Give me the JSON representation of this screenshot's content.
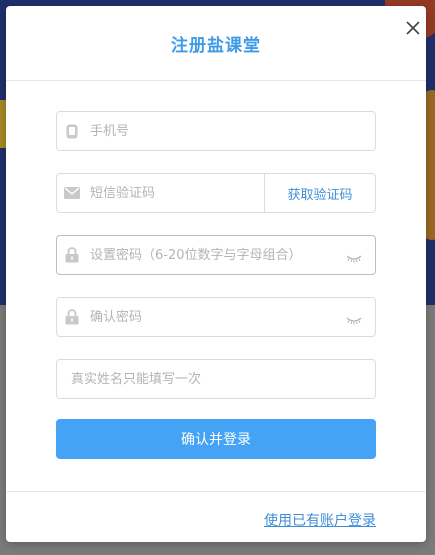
{
  "modal": {
    "title": "注册盐课堂",
    "close_icon": "close-icon"
  },
  "form": {
    "phone_placeholder": "手机号",
    "sms_code_placeholder": "短信验证码",
    "get_code_label": "获取验证码",
    "password_placeholder": "设置密码（6-20位数字与字母组合）",
    "confirm_password_placeholder": "确认密码",
    "real_name_placeholder": "真实姓名只能填写一次",
    "submit_label": "确认并登录"
  },
  "footer": {
    "existing_account_link": "使用已有账户登录"
  },
  "colors": {
    "accent": "#45a3f5",
    "title": "#3f9be8",
    "link": "#3f8fd8"
  }
}
